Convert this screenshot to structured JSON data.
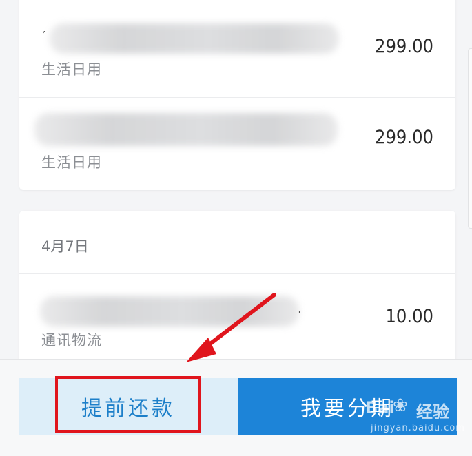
{
  "transactions_top": [
    {
      "leading_char": "′",
      "category": "生活日用",
      "amount": "299.00"
    },
    {
      "leading_char": "",
      "category": "生活日用",
      "amount": "299.00"
    }
  ],
  "date_group": {
    "date": "4月7日",
    "transactions": [
      {
        "trailing_char": ".",
        "category": "通讯物流",
        "amount": "10.00"
      }
    ]
  },
  "actions": {
    "prepay_label": "提前还款",
    "installment_label": "我要分期"
  },
  "watermark": {
    "brand": "Bai",
    "brand_suffix": "经验",
    "sub": "jingyan.baidu.com"
  },
  "colors": {
    "highlight": "#e0151d",
    "primary_blue": "#1d84d8",
    "light_blue": "#ddeef9"
  }
}
